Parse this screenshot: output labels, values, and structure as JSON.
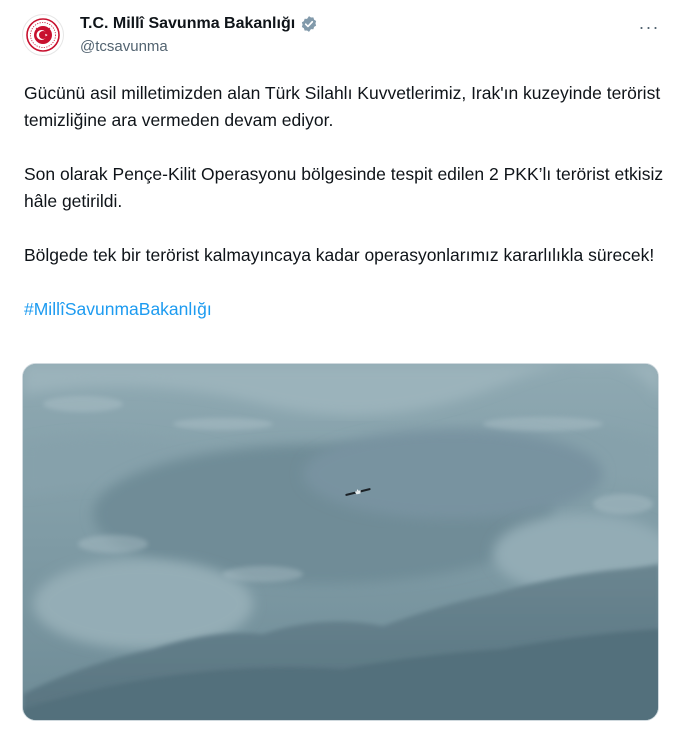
{
  "account": {
    "display_name": "T.C. Millî Savunma Bakanlığı",
    "handle": "@tcsavunma",
    "avatar_icon": "msb-emblem-icon",
    "verified_icon": "verified-badge-icon",
    "verified_color": "#829aab"
  },
  "tweet": {
    "paragraphs": [
      "Gücünü asil milletimizden alan Türk Silahlı Kuvvetlerimiz, Irak'ın kuzeyinde terörist temizliğine ara vermeden devam ediyor.",
      "Son olarak Pençe-Kilit Operasyonu bölgesinde tespit edilen 2 PKK’lı terörist etkisiz hâle getirildi.",
      "Bölgede tek bir terörist kalmayıncaya kadar operasyonlarımız kararlılıkla sürecek!"
    ],
    "hashtag": "#MillîSavunmaBakanlığı",
    "hashtag_color": "#1d9bf0"
  },
  "media": {
    "type": "aerial-image",
    "icon": "aerial-mountain-photo"
  },
  "menu": {
    "more_label": "···"
  }
}
